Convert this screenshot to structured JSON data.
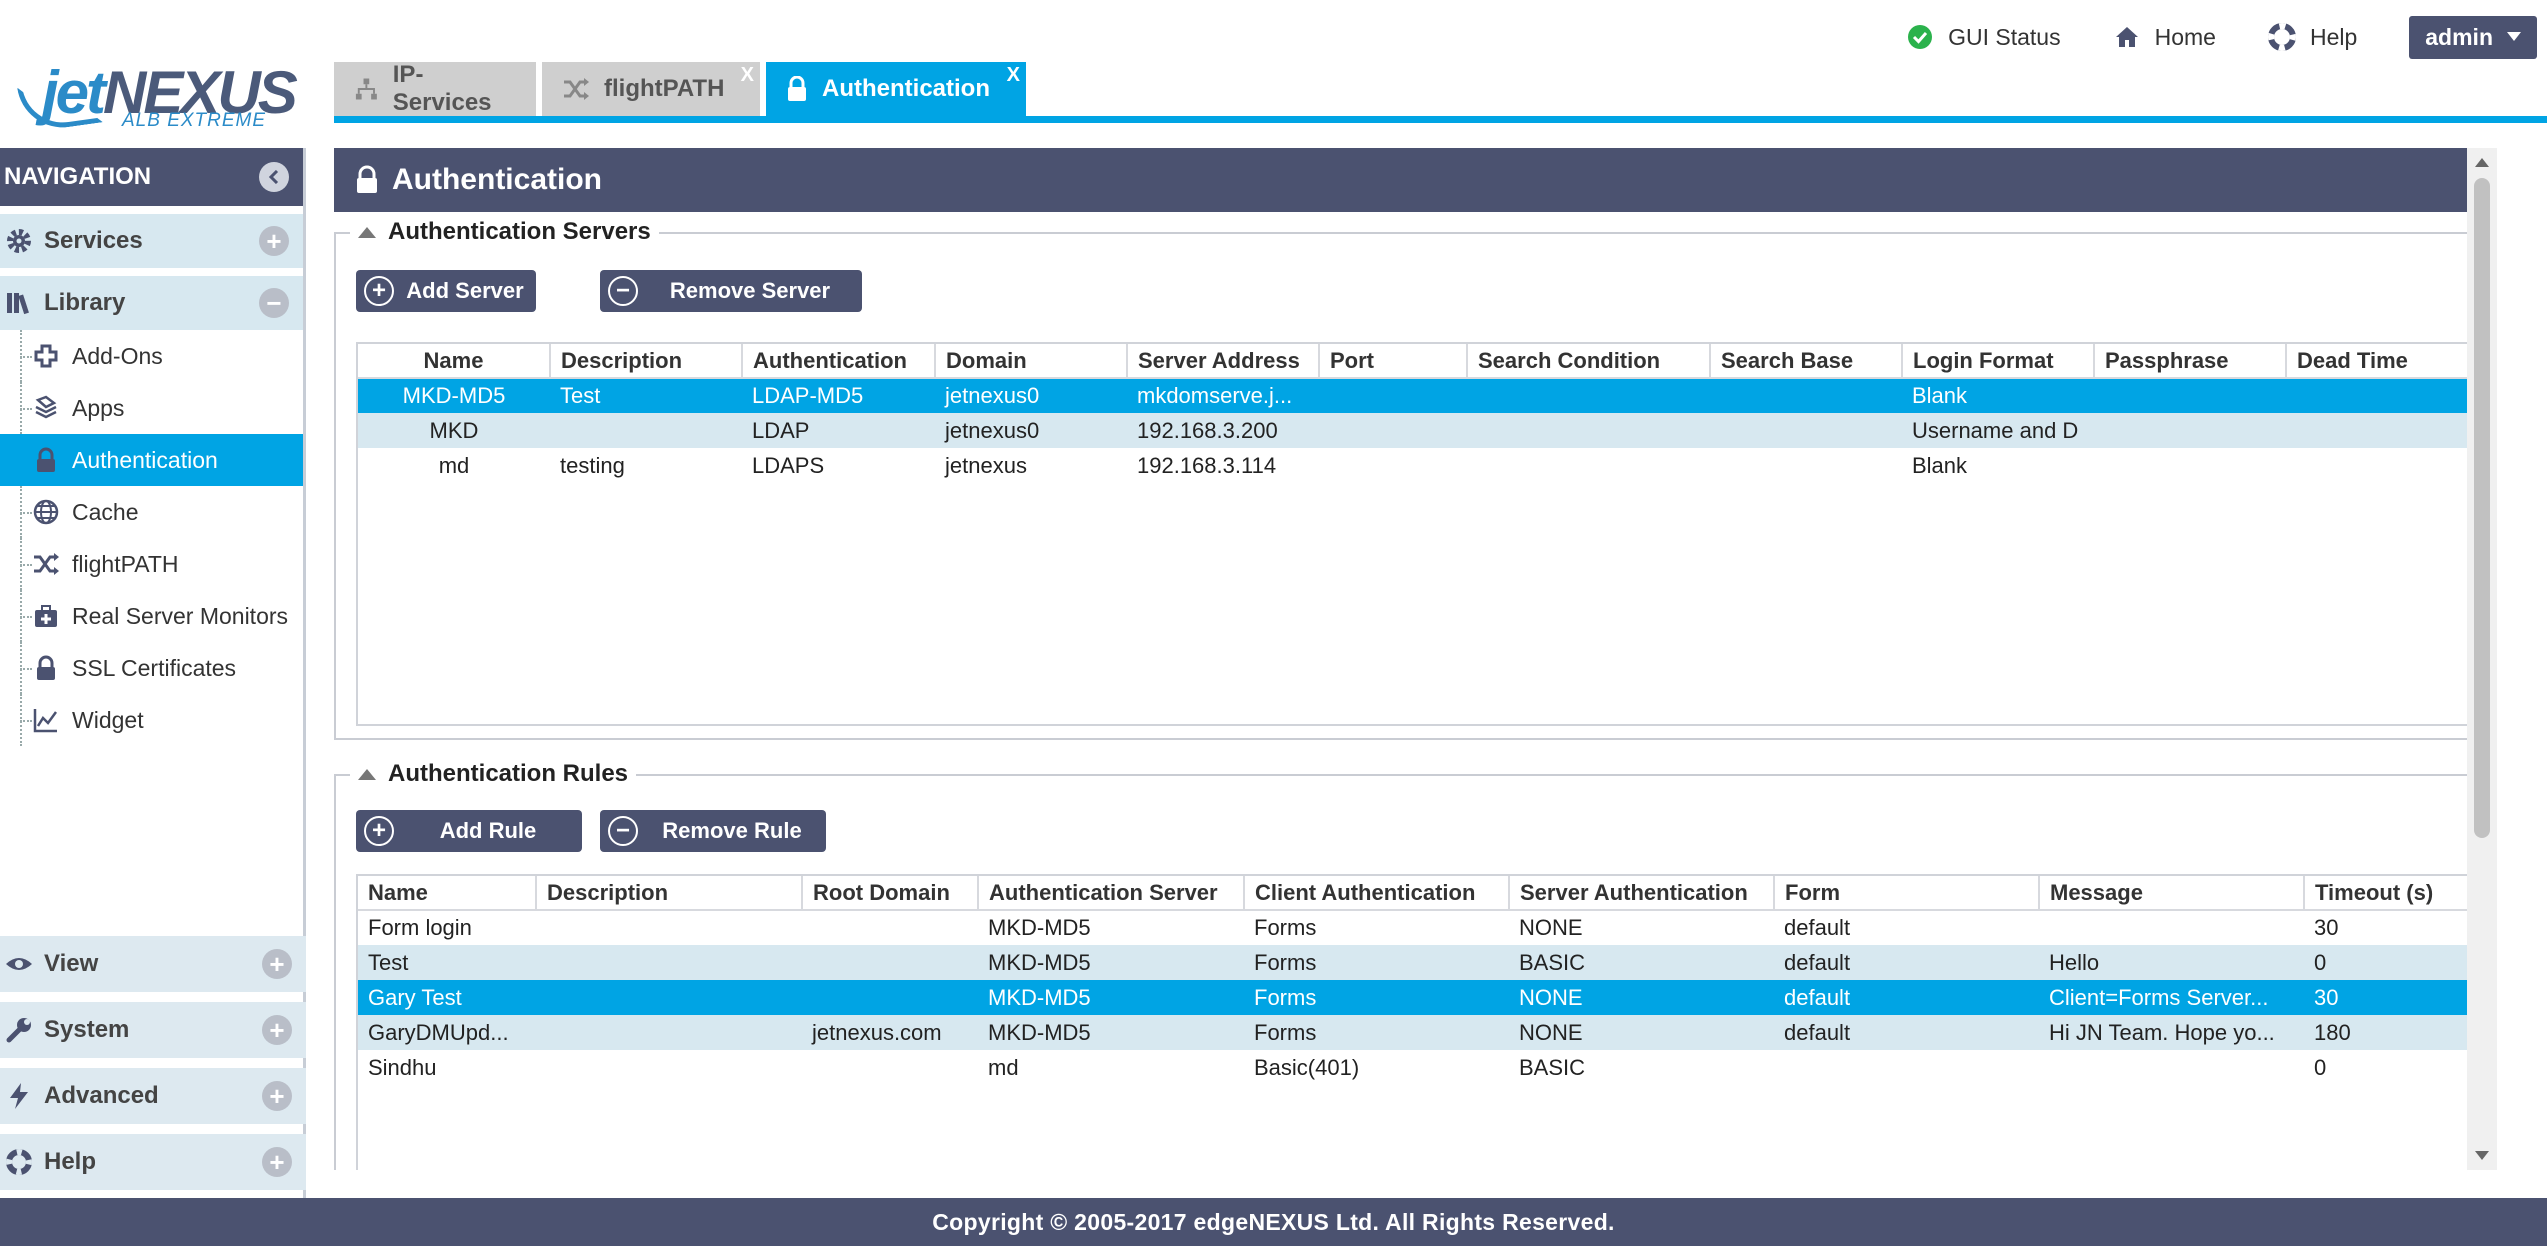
{
  "logo": {
    "jet": "jet",
    "nexus": "NEXUS",
    "sub": "ALB EXTREME"
  },
  "topnav": {
    "gui_status": "GUI Status",
    "home": "Home",
    "help": "Help",
    "user": "admin"
  },
  "tabs": [
    {
      "label": "IP-Services"
    },
    {
      "label": "flightPATH",
      "close": "X"
    },
    {
      "label": "Authentication",
      "close": "X"
    }
  ],
  "navigation": {
    "title": "NAVIGATION",
    "sections": {
      "services": "Services",
      "library": "Library",
      "view": "View",
      "system": "System",
      "advanced": "Advanced",
      "help": "Help"
    },
    "library_items": [
      "Add-Ons",
      "Apps",
      "Authentication",
      "Cache",
      "flightPATH",
      "Real Server Monitors",
      "SSL Certificates",
      "Widget"
    ]
  },
  "panel": {
    "title": "Authentication"
  },
  "servers": {
    "legend": "Authentication Servers",
    "add_label": "Add Server",
    "remove_label": "Remove Server",
    "columns": [
      "Name",
      "Description",
      "Authentication",
      "Domain",
      "Server Address",
      "Port",
      "Search Condition",
      "Search Base",
      "Login Format",
      "Passphrase",
      "Dead Time"
    ],
    "rows": [
      [
        "MKD-MD5",
        "Test",
        "LDAP-MD5",
        "jetnexus0",
        "mkdomserve.j...",
        "",
        "",
        "",
        "Blank",
        "",
        ""
      ],
      [
        "MKD",
        "",
        "LDAP",
        "jetnexus0",
        "192.168.3.200",
        "",
        "",
        "",
        "Username and D",
        "",
        ""
      ],
      [
        "md",
        "testing",
        "LDAPS",
        "jetnexus",
        "192.168.3.114",
        "",
        "",
        "",
        "Blank",
        "",
        ""
      ]
    ]
  },
  "rules": {
    "legend": "Authentication Rules",
    "add_label": "Add Rule",
    "remove_label": "Remove Rule",
    "columns": [
      "Name",
      "Description",
      "Root Domain",
      "Authentication Server",
      "Client Authentication",
      "Server Authentication",
      "Form",
      "Message",
      "Timeout (s)"
    ],
    "rows": [
      [
        "Form login",
        "",
        "",
        "MKD-MD5",
        "Forms",
        "NONE",
        "default",
        "",
        "30"
      ],
      [
        "Test",
        "",
        "",
        "MKD-MD5",
        "Forms",
        "BASIC",
        "default",
        "Hello",
        "0"
      ],
      [
        "Gary Test",
        "",
        "",
        "MKD-MD5",
        "Forms",
        "NONE",
        "default",
        "Client=Forms Server...",
        "30"
      ],
      [
        "GaryDMUpd...",
        "",
        "jetnexus.com",
        "MKD-MD5",
        "Forms",
        "NONE",
        "default",
        "Hi JN Team. Hope yo...",
        "180"
      ],
      [
        "Sindhu",
        "",
        "",
        "md",
        "Basic(401)",
        "BASIC",
        "",
        "",
        "0"
      ]
    ]
  },
  "footer": "Copyright © 2005-2017 edgeNEXUS Ltd. All Rights Reserved.",
  "colors": {
    "accent": "#00a4e4",
    "header": "#4b5270",
    "row_alt": "#d7e8f0",
    "status_ok": "#2bb24c"
  }
}
